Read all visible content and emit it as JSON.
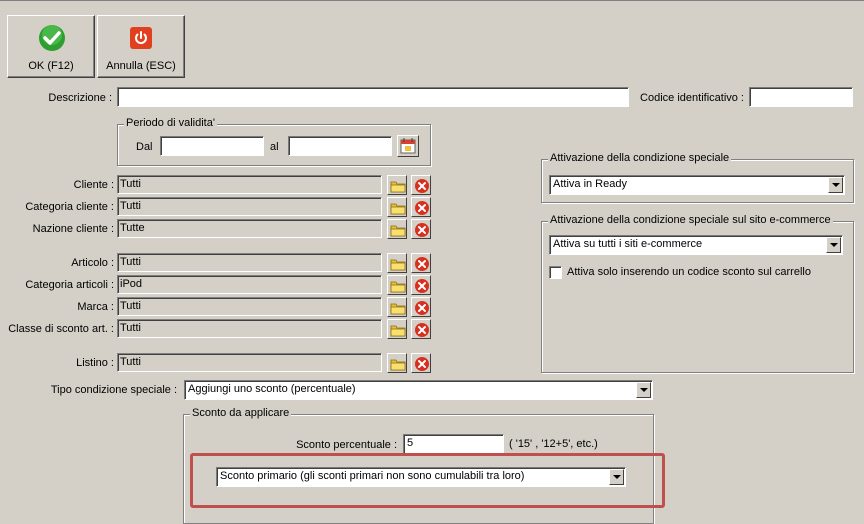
{
  "toolbar": {
    "ok_label": "OK (F12)",
    "cancel_label": "Annulla (ESC)"
  },
  "form": {
    "descrizione_label": "Descrizione :",
    "descrizione_value": "",
    "codice_label": "Codice identificativo :",
    "codice_value": "",
    "periodo": {
      "title": "Periodo di validita'",
      "dal_label": "Dal",
      "dal_value": "",
      "al_label": "al",
      "al_value": ""
    },
    "filters": [
      {
        "label": "Cliente :",
        "value": "Tutti"
      },
      {
        "label": "Categoria cliente :",
        "value": "Tutti"
      },
      {
        "label": "Nazione cliente :",
        "value": "Tutte"
      },
      {
        "label": "Articolo :",
        "value": "Tutti"
      },
      {
        "label": "Categoria articoli :",
        "value": "iPod"
      },
      {
        "label": "Marca :",
        "value": "Tutti"
      },
      {
        "label": "Classe di sconto art. :",
        "value": "Tutti"
      },
      {
        "label": "Listino :",
        "value": "Tutti"
      }
    ],
    "attivazione": {
      "title": "Attivazione della condizione speciale",
      "value": "Attiva in Ready"
    },
    "attivazione_sito": {
      "title": "Attivazione della condizione speciale sul sito e-commerce",
      "value": "Attiva su tutti i siti e-commerce",
      "checkbox_label": "Attiva solo inserendo un codice sconto sul carrello",
      "checkbox_checked": false
    },
    "tipo_label": "Tipo condizione speciale :",
    "tipo_value": "Aggiungi uno sconto (percentuale)",
    "sconto": {
      "title": "Sconto da applicare",
      "percent_label": "Sconto percentuale :",
      "percent_value": "5",
      "hint": "( '15' ,  '12+5', etc.)",
      "type_value": "Sconto primario (gli sconti primari non sono cumulabili tra loro)"
    }
  },
  "colors": {
    "window_bg": "#d4d0c8",
    "highlight_box": "#c0504d",
    "ok_icon": "#2e9e2e",
    "cancel_icon": "#e04020",
    "clear_icon": "#d83020",
    "folder_icon": "#f0d040"
  },
  "icons": {
    "ok": "check-circle-icon",
    "cancel": "power-icon",
    "calendar": "calendar-icon",
    "select": "folder-icon",
    "clear": "clear-x-icon"
  }
}
